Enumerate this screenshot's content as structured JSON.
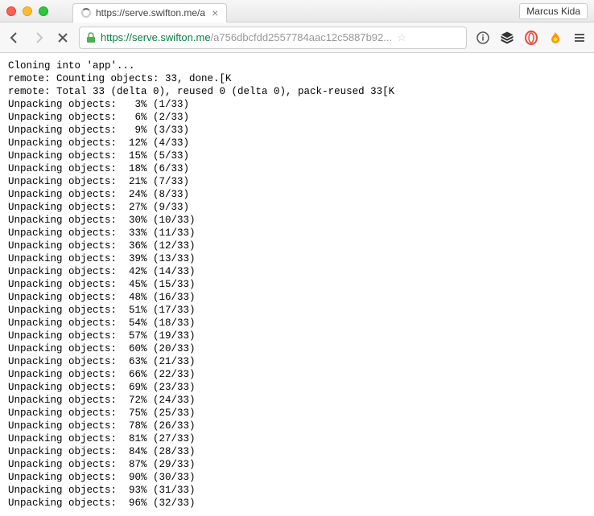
{
  "window": {
    "profile_name": "Marcus Kida"
  },
  "tab": {
    "title": "https://serve.swifton.me/a"
  },
  "urlbar": {
    "secure_part": "https://serve.swifton.me",
    "path_part": "/a756dbcfdd2557784aac12c5887b92..."
  },
  "terminal": {
    "header_lines": [
      "Cloning into 'app'...",
      "remote: Counting objects: 33, done.[K",
      "remote: Total 33 (delta 0), reused 0 (delta 0), pack-reused 33[K"
    ],
    "unpack_lines": [
      {
        "pct": "3%",
        "n": "1",
        "d": "33"
      },
      {
        "pct": "6%",
        "n": "2",
        "d": "33"
      },
      {
        "pct": "9%",
        "n": "3",
        "d": "33"
      },
      {
        "pct": "12%",
        "n": "4",
        "d": "33"
      },
      {
        "pct": "15%",
        "n": "5",
        "d": "33"
      },
      {
        "pct": "18%",
        "n": "6",
        "d": "33"
      },
      {
        "pct": "21%",
        "n": "7",
        "d": "33"
      },
      {
        "pct": "24%",
        "n": "8",
        "d": "33"
      },
      {
        "pct": "27%",
        "n": "9",
        "d": "33"
      },
      {
        "pct": "30%",
        "n": "10",
        "d": "33"
      },
      {
        "pct": "33%",
        "n": "11",
        "d": "33"
      },
      {
        "pct": "36%",
        "n": "12",
        "d": "33"
      },
      {
        "pct": "39%",
        "n": "13",
        "d": "33"
      },
      {
        "pct": "42%",
        "n": "14",
        "d": "33"
      },
      {
        "pct": "45%",
        "n": "15",
        "d": "33"
      },
      {
        "pct": "48%",
        "n": "16",
        "d": "33"
      },
      {
        "pct": "51%",
        "n": "17",
        "d": "33"
      },
      {
        "pct": "54%",
        "n": "18",
        "d": "33"
      },
      {
        "pct": "57%",
        "n": "19",
        "d": "33"
      },
      {
        "pct": "60%",
        "n": "20",
        "d": "33"
      },
      {
        "pct": "63%",
        "n": "21",
        "d": "33"
      },
      {
        "pct": "66%",
        "n": "22",
        "d": "33"
      },
      {
        "pct": "69%",
        "n": "23",
        "d": "33"
      },
      {
        "pct": "72%",
        "n": "24",
        "d": "33"
      },
      {
        "pct": "75%",
        "n": "25",
        "d": "33"
      },
      {
        "pct": "78%",
        "n": "26",
        "d": "33"
      },
      {
        "pct": "81%",
        "n": "27",
        "d": "33"
      },
      {
        "pct": "84%",
        "n": "28",
        "d": "33"
      },
      {
        "pct": "87%",
        "n": "29",
        "d": "33"
      },
      {
        "pct": "90%",
        "n": "30",
        "d": "33"
      },
      {
        "pct": "93%",
        "n": "31",
        "d": "33"
      },
      {
        "pct": "96%",
        "n": "32",
        "d": "33"
      }
    ]
  }
}
